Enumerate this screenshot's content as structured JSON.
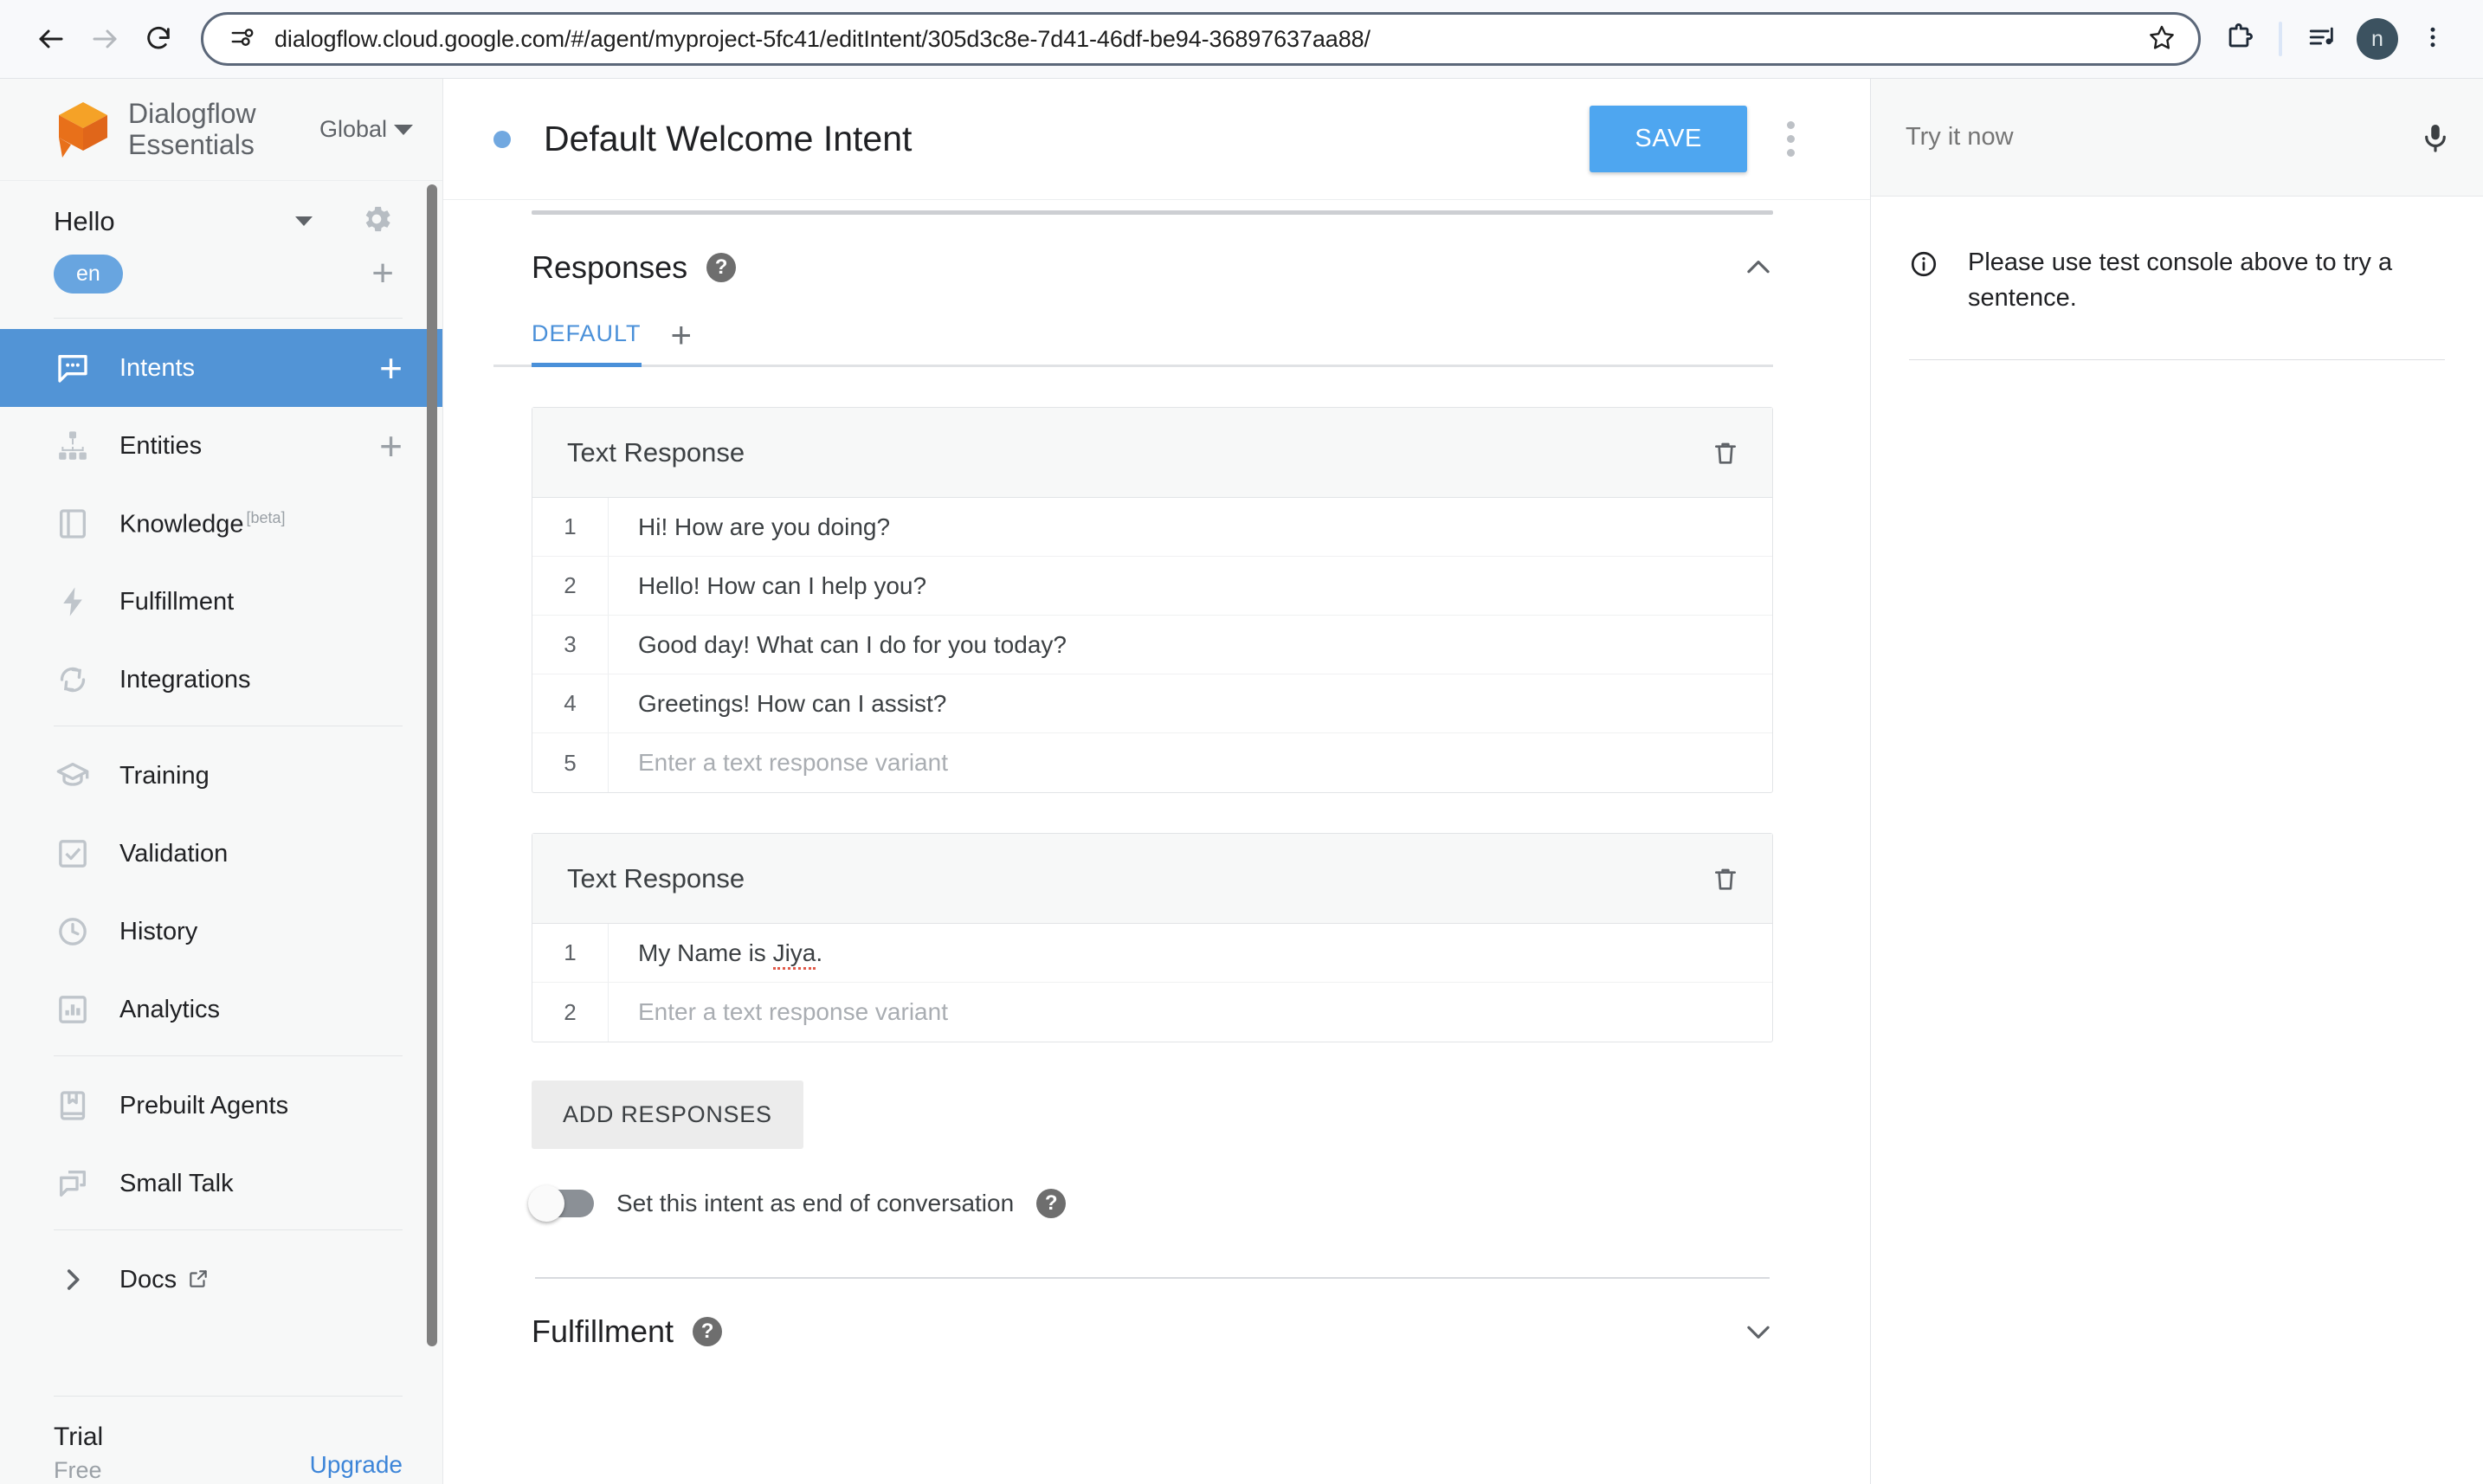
{
  "browser": {
    "back_icon": "back-arrow-icon",
    "forward_icon": "forward-arrow-icon",
    "reload_icon": "reload-icon",
    "site_info_icon": "site-settings-icon",
    "url": "dialogflow.cloud.google.com/#/agent/myproject-5fc41/editIntent/305d3c8e-7d41-46df-be94-36897637aa88/",
    "bookmark_icon": "star-icon",
    "extensions_icon": "puzzle-piece-icon",
    "media_icon": "media-playlist-icon",
    "profile_initial": "n",
    "menu_icon": "three-dot-menu-icon"
  },
  "sidebar": {
    "brand": "Dialogflow Essentials",
    "brand_logo": "dialogflow-logo-icon",
    "region": "Global",
    "agent_name": "Hello",
    "settings_icon": "gear-icon",
    "language_chip": "en",
    "add_language_label": "+",
    "nav": [
      {
        "label": "Intents",
        "icon": "intents-chat-icon",
        "active": true,
        "plus": "+"
      },
      {
        "label": "Entities",
        "icon": "entities-hierarchy-icon",
        "active": false,
        "plus": "+"
      },
      {
        "label": "Knowledge",
        "icon": "knowledge-book-icon",
        "active": false,
        "beta": "[beta]"
      },
      {
        "label": "Fulfillment",
        "icon": "fulfillment-bolt-icon",
        "active": false
      },
      {
        "label": "Integrations",
        "icon": "integrations-sync-icon",
        "active": false
      }
    ],
    "nav2": [
      {
        "label": "Training",
        "icon": "training-cap-icon"
      },
      {
        "label": "Validation",
        "icon": "validation-check-icon"
      },
      {
        "label": "History",
        "icon": "history-clock-icon"
      },
      {
        "label": "Analytics",
        "icon": "analytics-bars-icon"
      }
    ],
    "nav3": [
      {
        "label": "Prebuilt Agents",
        "icon": "prebuilt-agents-book-icon"
      },
      {
        "label": "Small Talk",
        "icon": "small-talk-bubbles-icon"
      }
    ],
    "docs": {
      "label": "Docs",
      "icon": "chevron-right-icon",
      "external_icon": "external-link-icon"
    },
    "plan": {
      "title": "Trial",
      "subtitle": "Free",
      "upgrade": "Upgrade"
    }
  },
  "header": {
    "status_dot": "unsaved-status-dot",
    "title": "Default Welcome Intent",
    "save_label": "SAVE",
    "menu_icon": "three-dot-menu-icon"
  },
  "responses": {
    "section_title": "Responses",
    "help_icon": "help-icon",
    "collapse_icon": "chevron-up-icon",
    "tabs": [
      {
        "label": "DEFAULT",
        "selected": true
      }
    ],
    "add_tab_label": "+",
    "cards": [
      {
        "title": "Text Response",
        "delete_icon": "trash-icon",
        "variants": [
          {
            "n": "1",
            "text": "Hi! How are you doing?",
            "placeholder": false
          },
          {
            "n": "2",
            "text": "Hello! How can I help you?",
            "placeholder": false
          },
          {
            "n": "3",
            "text": "Good day! What can I do for you today?",
            "placeholder": false
          },
          {
            "n": "4",
            "text": "Greetings! How can I assist?",
            "placeholder": false
          },
          {
            "n": "5",
            "text": "Enter a text response variant",
            "placeholder": true
          }
        ]
      },
      {
        "title": "Text Response",
        "delete_icon": "trash-icon",
        "variants": [
          {
            "n": "1",
            "text": "My Name is ",
            "misspelled": "Jiya",
            "tail": ".",
            "placeholder": false
          },
          {
            "n": "2",
            "text": "Enter a text response variant",
            "placeholder": true
          }
        ]
      }
    ],
    "add_responses_label": "ADD RESPONSES",
    "end_of_conversation_label": "Set this intent as end of conversation",
    "end_of_conversation_on": false,
    "end_help_icon": "help-icon"
  },
  "fulfillment": {
    "section_title": "Fulfillment",
    "help_icon": "help-icon",
    "expand_icon": "chevron-down-icon"
  },
  "trypanel": {
    "placeholder": "Try it now",
    "mic_icon": "microphone-icon",
    "info_icon": "info-icon",
    "message": "Please use test console above to try a sentence."
  },
  "colors": {
    "accent_blue": "#5294d6",
    "save_blue": "#4ea6f0",
    "link_blue": "#3d85d8",
    "logo_orange": "#ef8023"
  }
}
